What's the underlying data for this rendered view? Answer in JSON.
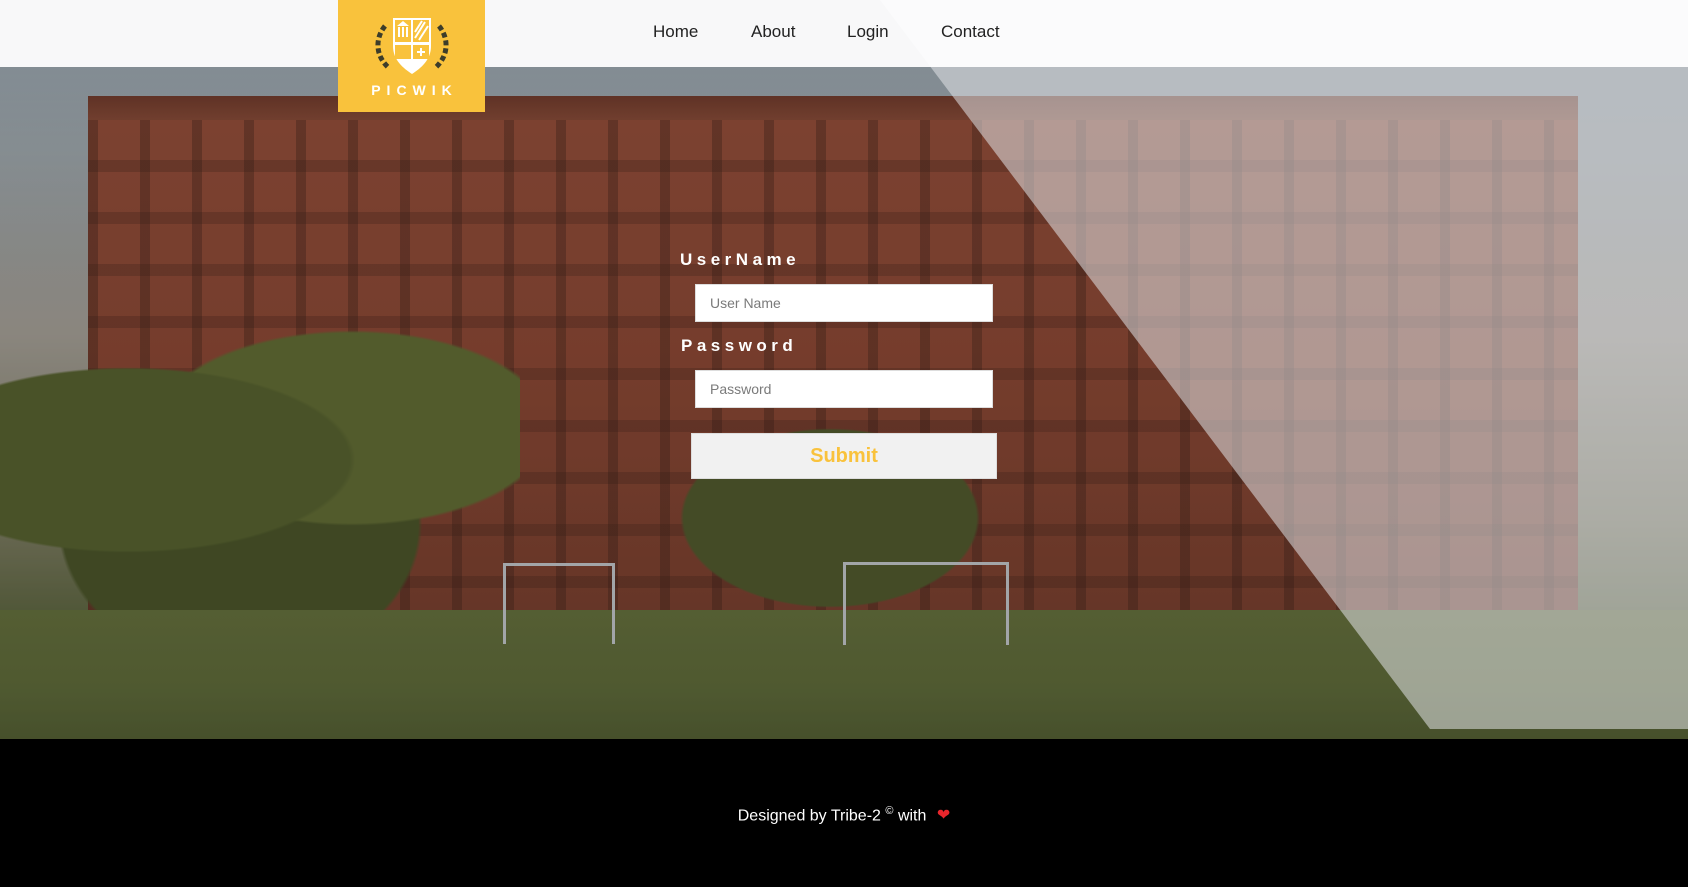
{
  "logo": {
    "text": "PICWIK",
    "color": "#f9c23c"
  },
  "nav": {
    "items": [
      {
        "label": "Home"
      },
      {
        "label": "About"
      },
      {
        "label": "Login"
      },
      {
        "label": "Contact"
      }
    ]
  },
  "login_form": {
    "username_label": "UserName",
    "username_placeholder": "User Name",
    "password_label": "Password",
    "password_placeholder": "Password",
    "submit_label": "Submit"
  },
  "footer": {
    "prefix": "Designed by Tribe-2",
    "copyright_symbol": "©",
    "suffix": "with",
    "heart_icon": "heart-icon",
    "heart_glyph": "❤"
  },
  "colors": {
    "accent": "#f9c23c",
    "footer_bg": "#000000",
    "heart": "#e8262c"
  }
}
